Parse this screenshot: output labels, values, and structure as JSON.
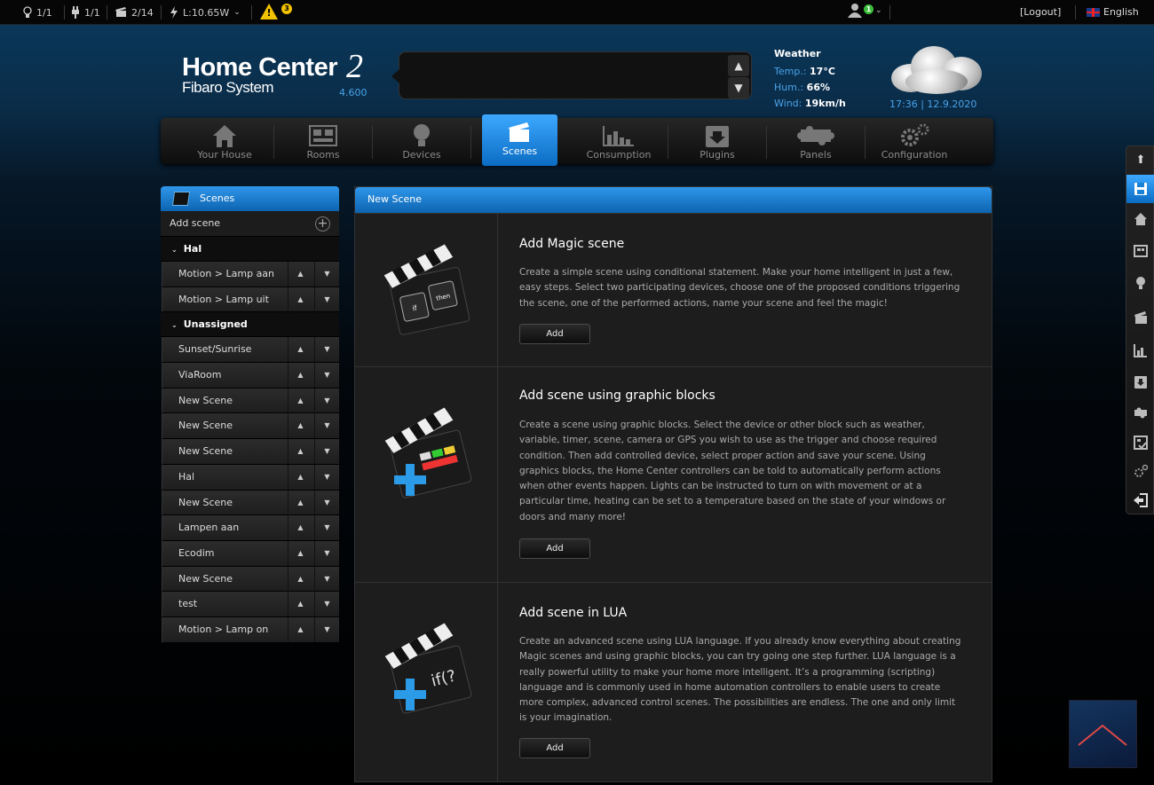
{
  "statusbar": {
    "lights": "1/1",
    "plugs": "1/1",
    "scenes": "2/14",
    "load": "L:10.65W",
    "warnings": "3",
    "users_online": "1",
    "logout": "[Logout]",
    "language": "English"
  },
  "header": {
    "logo_title": "Home Center",
    "logo_number": "2",
    "logo_subtitle": "Fibaro System",
    "version": "4.600"
  },
  "weather": {
    "title": "Weather",
    "temp_label": "Temp.:",
    "temp_value": "17°C",
    "hum_label": "Hum.:",
    "hum_value": "66%",
    "wind_label": "Wind:",
    "wind_value": "19km/h",
    "time": "17:36",
    "date": "12.9.2020"
  },
  "nav": {
    "items": [
      {
        "label": "Your House",
        "icon": "house-icon"
      },
      {
        "label": "Rooms",
        "icon": "rooms-icon"
      },
      {
        "label": "Devices",
        "icon": "bulb-icon"
      },
      {
        "label": "Scenes",
        "icon": "clapper-icon"
      },
      {
        "label": "Consumption",
        "icon": "chart-icon"
      },
      {
        "label": "Plugins",
        "icon": "plugin-icon"
      },
      {
        "label": "Panels",
        "icon": "puzzle-icon"
      },
      {
        "label": "Configuration",
        "icon": "gears-icon"
      }
    ],
    "active": "Scenes"
  },
  "sidebar": {
    "title": "Scenes",
    "add_scene": "Add scene",
    "group_hal": "Hal",
    "hal_scenes": [
      "Motion > Lamp aan",
      "Motion > Lamp uit"
    ],
    "group_unassigned": "Unassigned",
    "unassigned_scenes": [
      "Sunset/Sunrise",
      "ViaRoom",
      "New Scene",
      "New Scene",
      "New Scene",
      "Hal",
      "New Scene",
      "Lampen aan",
      "Ecodim",
      "New Scene",
      "test",
      "Motion > Lamp on"
    ]
  },
  "main": {
    "header": "New Scene",
    "options": [
      {
        "title": "Add Magic scene",
        "description": "Create a simple scene using conditional statement. Make your home intelligent in just a few, easy steps. Select two participating devices, choose one of the proposed conditions triggering the scene, one of the performed actions, name your scene and feel the magic!",
        "button": "Add"
      },
      {
        "title": "Add scene using graphic blocks",
        "description": "Create a scene using graphic blocks. Select the device or other block such as weather, variable, timer, scene, camera or GPS you wish to use as the trigger and choose required condition. Then add controlled device, select proper action and save your scene. Using graphics blocks, the Home Center controllers can be told to automatically perform actions when other events happen. Lights can be instructed to turn on with movement or at a particular time, heating can be set to a temperature based on the state of your windows or doors and many more!",
        "button": "Add"
      },
      {
        "title": "Add scene in LUA",
        "description": "Create an advanced scene using LUA language. If you already know everything about creating Magic scenes and using graphic blocks, you can try going one step further. LUA language is a really powerful utility to make your home more intelligent. It’s a programming (scripting) language and is commonly used in home automation controllers to enable users to create more complex, advanced control scenes. The possibilities are endless. The one and only limit is your imagination.",
        "button": "Add"
      }
    ]
  },
  "icon_text": {
    "magic_if": "if",
    "magic_then": "then",
    "lua_code": "if(?"
  },
  "right_toolbar": [
    "arrow-up-icon",
    "save-icon",
    "house-icon",
    "rooms-icon",
    "bulb-icon",
    "clapper-icon",
    "chart-icon",
    "plugin-icon",
    "puzzle-icon",
    "panel-icon",
    "gears-icon",
    "logout-icon"
  ],
  "colors": {
    "accent": "#1a82d6",
    "warning": "#f2c200",
    "online": "#3cbf3c"
  }
}
